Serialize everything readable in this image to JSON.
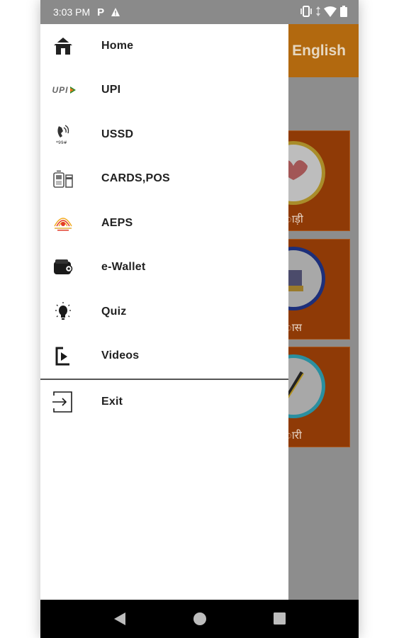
{
  "status_bar": {
    "time": "3:03 PM",
    "p_icon": "P"
  },
  "background": {
    "header_text": "| English",
    "tiles": [
      "ाड़ी",
      "ास",
      "ारी"
    ]
  },
  "drawer": {
    "items": [
      {
        "label": "Home",
        "icon": "home-icon"
      },
      {
        "label": "UPI",
        "icon": "upi-logo-icon"
      },
      {
        "label": "USSD",
        "icon": "ussd-phone-icon"
      },
      {
        "label": "CARDS,POS",
        "icon": "cards-pos-icon"
      },
      {
        "label": "AEPS",
        "icon": "aeps-aadhaar-icon"
      },
      {
        "label": "e-Wallet",
        "icon": "wallet-icon"
      },
      {
        "label": "Quiz",
        "icon": "quiz-bulb-icon"
      },
      {
        "label": "Videos",
        "icon": "video-play-icon"
      },
      {
        "label": "Exit",
        "icon": "exit-icon"
      }
    ],
    "upi_icon_text": "UPI"
  },
  "colors": {
    "status_bar": "#8a8a8a",
    "header_dimmed": "#b2690f",
    "tile_dimmed": "#8f3a06",
    "nav_bar": "#000000"
  }
}
